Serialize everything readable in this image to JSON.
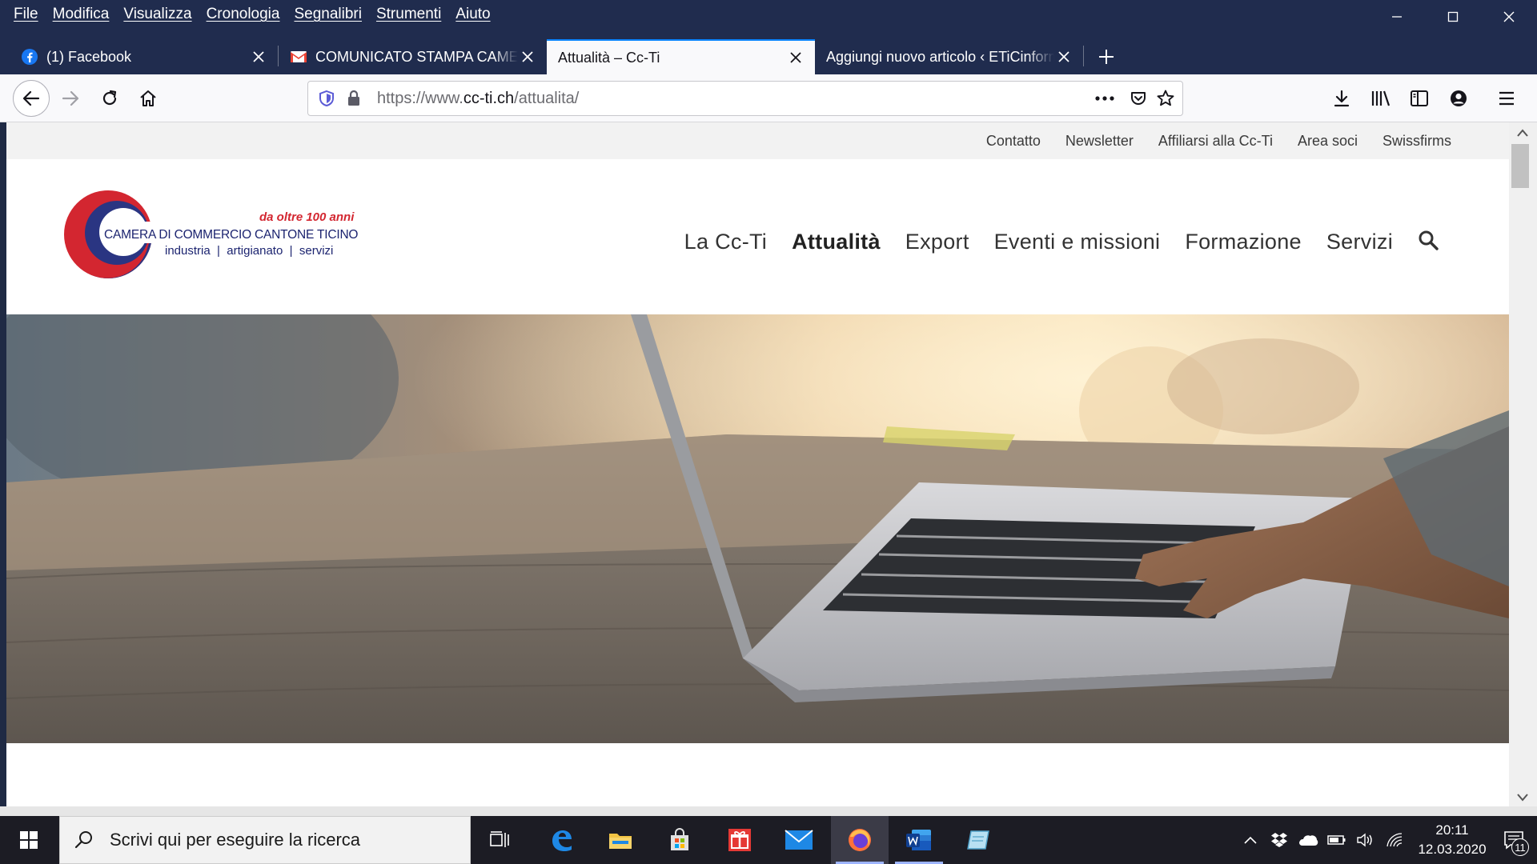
{
  "menu": [
    "File",
    "Modifica",
    "Visualizza",
    "Cronologia",
    "Segnalibri",
    "Strumenti",
    "Aiuto"
  ],
  "tabs": [
    {
      "label": "(1) Facebook",
      "favicon": "facebook-icon"
    },
    {
      "label": "COMUNICATO STAMPA CAMERA",
      "favicon": "gmail-icon"
    },
    {
      "label": "Attualità – Cc-Ti",
      "favicon": ""
    },
    {
      "label": "Aggiungi nuovo articolo ‹ ETiCinform",
      "favicon": ""
    }
  ],
  "url": {
    "scheme": "https://www.",
    "host": "cc-ti.ch",
    "path": "/attualita/"
  },
  "site": {
    "top_links": [
      "Contatto",
      "Newsletter",
      "Affiliarsi alla Cc-Ti",
      "Area soci",
      "Swissfirms"
    ],
    "logo": {
      "tagline": "da oltre 100 anni",
      "name": "CAMERA DI COMMERCIO CANTONE TICINO",
      "sub": "industria  |  artigianato  |  servizi"
    },
    "main_nav": [
      "La Cc-Ti",
      "Attualità",
      "Export",
      "Eventi e missioni",
      "Formazione",
      "Servizi"
    ],
    "active_nav": "Attualità"
  },
  "taskbar": {
    "search_placeholder": "Scrivi qui per eseguire la ricerca",
    "time": "20:11",
    "date": "12.03.2020",
    "notifications": "11"
  },
  "colors": {
    "titlebar": "#202c4e",
    "accent": "#0a84ff",
    "logo_red": "#d32630",
    "logo_blue": "#2a3582"
  }
}
